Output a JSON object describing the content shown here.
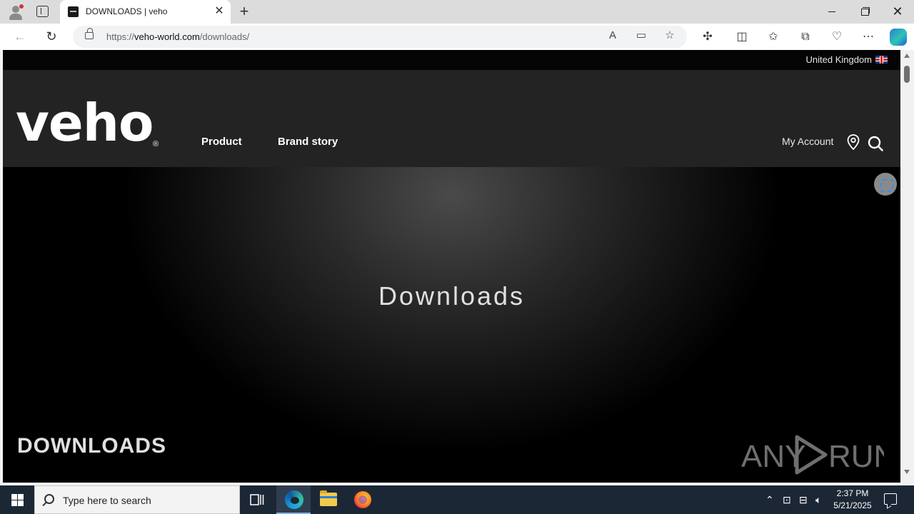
{
  "browser": {
    "tab": {
      "title": "DOWNLOADS | veho",
      "close_label": "✕"
    },
    "new_tab_label": "+",
    "window_controls": {
      "close_label": "✕"
    },
    "address": {
      "url_prefix": "https://",
      "url_host": "veho-world.com",
      "url_path": "/downloads/"
    }
  },
  "site": {
    "region": {
      "label": "United Kingdom",
      "flag_icon": "uk-flag-icon"
    },
    "logo": {
      "text": "veho",
      "mark": "®"
    },
    "nav": [
      {
        "label": "Product"
      },
      {
        "label": "Brand story"
      }
    ],
    "account_label": "My Account",
    "hero": {
      "title": "Downloads",
      "footer_heading": "DOWNLOADS"
    },
    "watermark_text": "ANY RUN"
  },
  "taskbar": {
    "search_placeholder": "Type here to search",
    "clock": {
      "time": "2:37 PM",
      "date": "5/21/2025"
    }
  },
  "colors": {
    "header_bg": "#232323",
    "tabstrip_bg": "#dcdcdc",
    "taskbar_bg": "#1c2735"
  }
}
